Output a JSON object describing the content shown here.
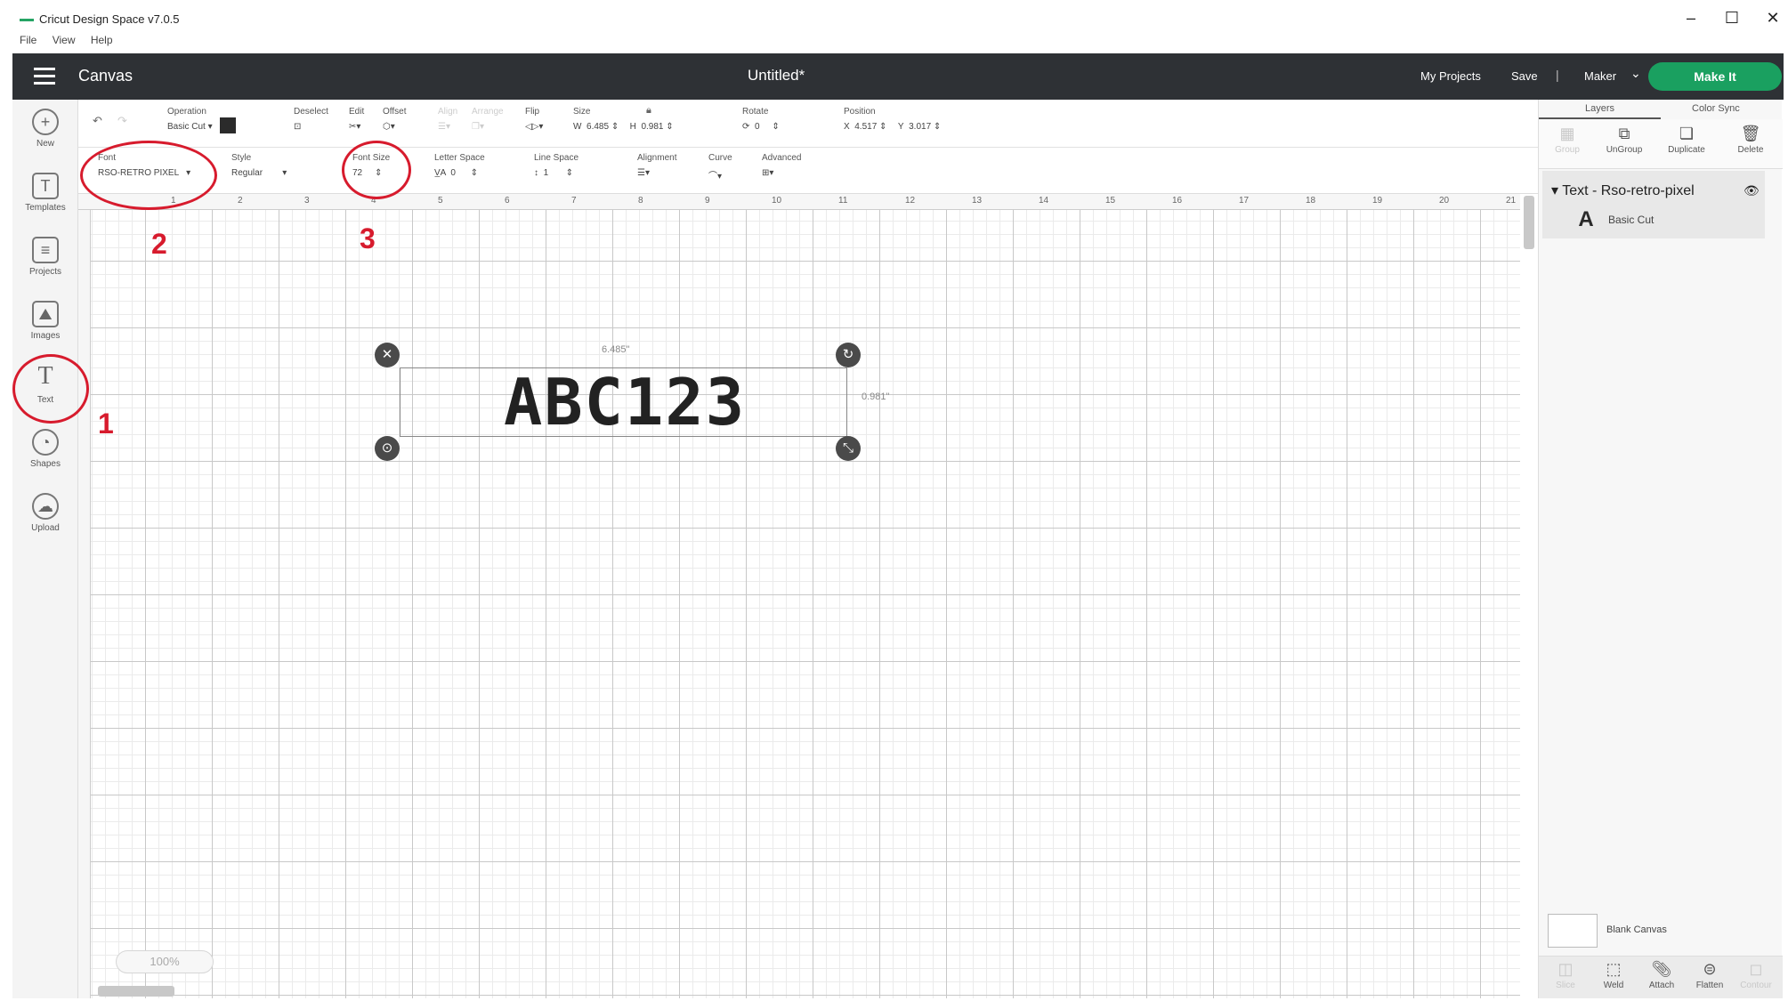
{
  "window": {
    "title": "Cricut Design Space  v7.0.5",
    "controls": {
      "minimize": "–",
      "maximize": "☐",
      "close": "✕"
    },
    "menu": [
      "File",
      "View",
      "Help"
    ]
  },
  "header": {
    "canvas_label": "Canvas",
    "document_title": "Untitled*",
    "my_projects": "My Projects",
    "save": "Save",
    "separator": "|",
    "machine": "Maker",
    "make_it": "Make It",
    "accent_color": "#1aa060"
  },
  "left_toolbar": [
    {
      "label": "New",
      "icon": "plus-circle-icon",
      "glyph": "+"
    },
    {
      "label": "Templates",
      "icon": "shirt-icon",
      "glyph": "T"
    },
    {
      "label": "Projects",
      "icon": "book-icon",
      "glyph": "≡"
    },
    {
      "label": "Images",
      "icon": "image-icon",
      "glyph": "⛰"
    },
    {
      "label": "Text",
      "icon": "text-icon",
      "glyph": "T"
    },
    {
      "label": "Shapes",
      "icon": "shapes-icon",
      "glyph": "◔"
    },
    {
      "label": "Upload",
      "icon": "cloud-upload-icon",
      "glyph": "☁"
    }
  ],
  "edit_toolbar": {
    "undo_icon": "undo-icon",
    "operation": {
      "label": "Operation",
      "value": "Basic Cut"
    },
    "deselect": {
      "label": "Deselect"
    },
    "edit": {
      "label": "Edit"
    },
    "offset": {
      "label": "Offset"
    },
    "align": {
      "label": "Align"
    },
    "arrange": {
      "label": "Arrange"
    },
    "flip": {
      "label": "Flip"
    },
    "size": {
      "label": "Size",
      "w_label": "W",
      "w": "6.485",
      "h_label": "H",
      "h": "0.981"
    },
    "rotate": {
      "label": "Rotate",
      "value": "0"
    },
    "position": {
      "label": "Position",
      "x_label": "X",
      "x": "4.517",
      "y_label": "Y",
      "y": "3.017"
    }
  },
  "text_toolbar": {
    "font": {
      "label": "Font",
      "value": "RSO-RETRO PIXEL"
    },
    "style": {
      "label": "Style",
      "value": "Regular"
    },
    "font_size": {
      "label": "Font Size",
      "value": "72"
    },
    "letter_space": {
      "label": "Letter Space",
      "value": "0"
    },
    "line_space": {
      "label": "Line Space",
      "value": "1"
    },
    "alignment": {
      "label": "Alignment"
    },
    "curve": {
      "label": "Curve"
    },
    "advanced": {
      "label": "Advanced"
    }
  },
  "ruler_top": [
    "1",
    "2",
    "3",
    "4",
    "5",
    "6",
    "7",
    "8",
    "9",
    "10",
    "11",
    "12",
    "13",
    "14",
    "15",
    "16",
    "17",
    "18",
    "19",
    "20",
    "21"
  ],
  "canvas": {
    "text_object": "ABC123",
    "width_label": "6.485\"",
    "height_label": "0.981\"",
    "zoom": "100%"
  },
  "annotations": [
    "1",
    "2",
    "3"
  ],
  "annotation_color": "#d71b2d",
  "right_panel": {
    "tabs": [
      "Layers",
      "Color Sync"
    ],
    "actions": [
      {
        "label": "Group",
        "enabled": false,
        "icon": "group-icon"
      },
      {
        "label": "UnGroup",
        "enabled": true,
        "icon": "ungroup-icon"
      },
      {
        "label": "Duplicate",
        "enabled": true,
        "icon": "duplicate-icon"
      },
      {
        "label": "Delete",
        "enabled": true,
        "icon": "delete-icon"
      }
    ],
    "layer_title": "Text - Rso-retro-pixel",
    "layer_item": "Basic Cut",
    "blank_canvas": "Blank Canvas",
    "bottom_actions": [
      {
        "label": "Slice",
        "enabled": false,
        "icon": "slice-icon"
      },
      {
        "label": "Weld",
        "enabled": true,
        "icon": "weld-icon"
      },
      {
        "label": "Attach",
        "enabled": true,
        "icon": "attach-icon"
      },
      {
        "label": "Flatten",
        "enabled": true,
        "icon": "flatten-icon"
      },
      {
        "label": "Contour",
        "enabled": false,
        "icon": "contour-icon"
      }
    ]
  }
}
